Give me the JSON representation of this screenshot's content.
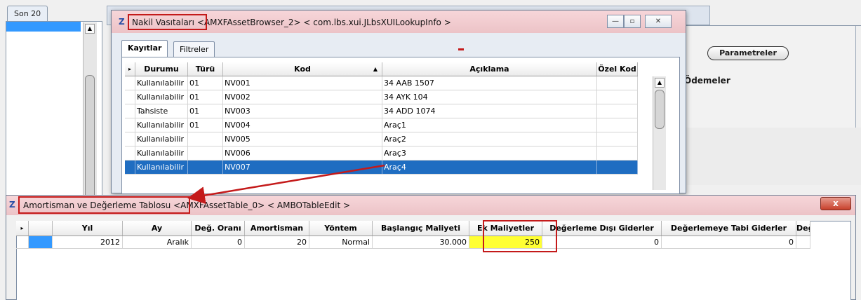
{
  "background": {
    "tab_label": "Son 20",
    "parameters_button": "Parametreler",
    "payments_label": "Ödemeler"
  },
  "lookup_window": {
    "title_highlight": "Nakil Vasıtaları",
    "title_rest": "<AMXFAssetBrowser_2> < com.lbs.xui.JLbsXUILookupInfo >",
    "controls": [
      "minimize-icon",
      "maximize-icon",
      "close-icon"
    ],
    "tabs": [
      "Kayıtlar",
      "Filtreler"
    ],
    "active_tab": "Kayıtlar",
    "columns": [
      "Durumu",
      "Türü",
      "Kod",
      "Açıklama",
      "Özel Kod"
    ],
    "sort_column": "Kod",
    "rows": [
      {
        "durum": "Kullanılabilir",
        "tur": "01",
        "kod": "NV001",
        "aciklama": "34 AAB 1507",
        "ozel": ""
      },
      {
        "durum": "Kullanılabilir",
        "tur": "01",
        "kod": "NV002",
        "aciklama": "34 AYK 104",
        "ozel": ""
      },
      {
        "durum": "Tahsiste",
        "tur": "01",
        "kod": "NV003",
        "aciklama": "34 ADD 1074",
        "ozel": ""
      },
      {
        "durum": "Kullanılabilir",
        "tur": "01",
        "kod": "NV004",
        "aciklama": "Araç1",
        "ozel": ""
      },
      {
        "durum": "Kullanılabilir",
        "tur": "",
        "kod": "NV005",
        "aciklama": "Araç2",
        "ozel": ""
      },
      {
        "durum": "Kullanılabilir",
        "tur": "",
        "kod": "NV006",
        "aciklama": "Araç3",
        "ozel": ""
      },
      {
        "durum": "Kullanılabilir",
        "tur": "",
        "kod": "NV007",
        "aciklama": "Araç4",
        "ozel": ""
      }
    ],
    "selected_row": 6
  },
  "table_window": {
    "title_highlight": "Amortisman ve Değerleme Tablosu",
    "title_rest": "<AMXFAssetTable_0> < AMBOTableEdit >",
    "close_label": "x",
    "columns": [
      "Yıl",
      "Ay",
      "Değ. Oranı",
      "Amortisman",
      "Yöntem",
      "Başlangıç Maliyeti",
      "Ek Maliyetler",
      "Değerleme Dışı Giderler",
      "Değerlemeye Tabi Giderler",
      "Değ"
    ],
    "row": [
      "2012",
      "Aralık",
      "0",
      "20",
      "Normal",
      "30.000",
      "250",
      "0",
      "0",
      ""
    ],
    "highlighted_column": "Ek Maliyetler"
  },
  "colors": {
    "accent_red": "#c41a1a",
    "selection_blue": "#1f6dc1",
    "highlight_yellow": "#ffff33",
    "title_pink": "#f2ccd0"
  }
}
